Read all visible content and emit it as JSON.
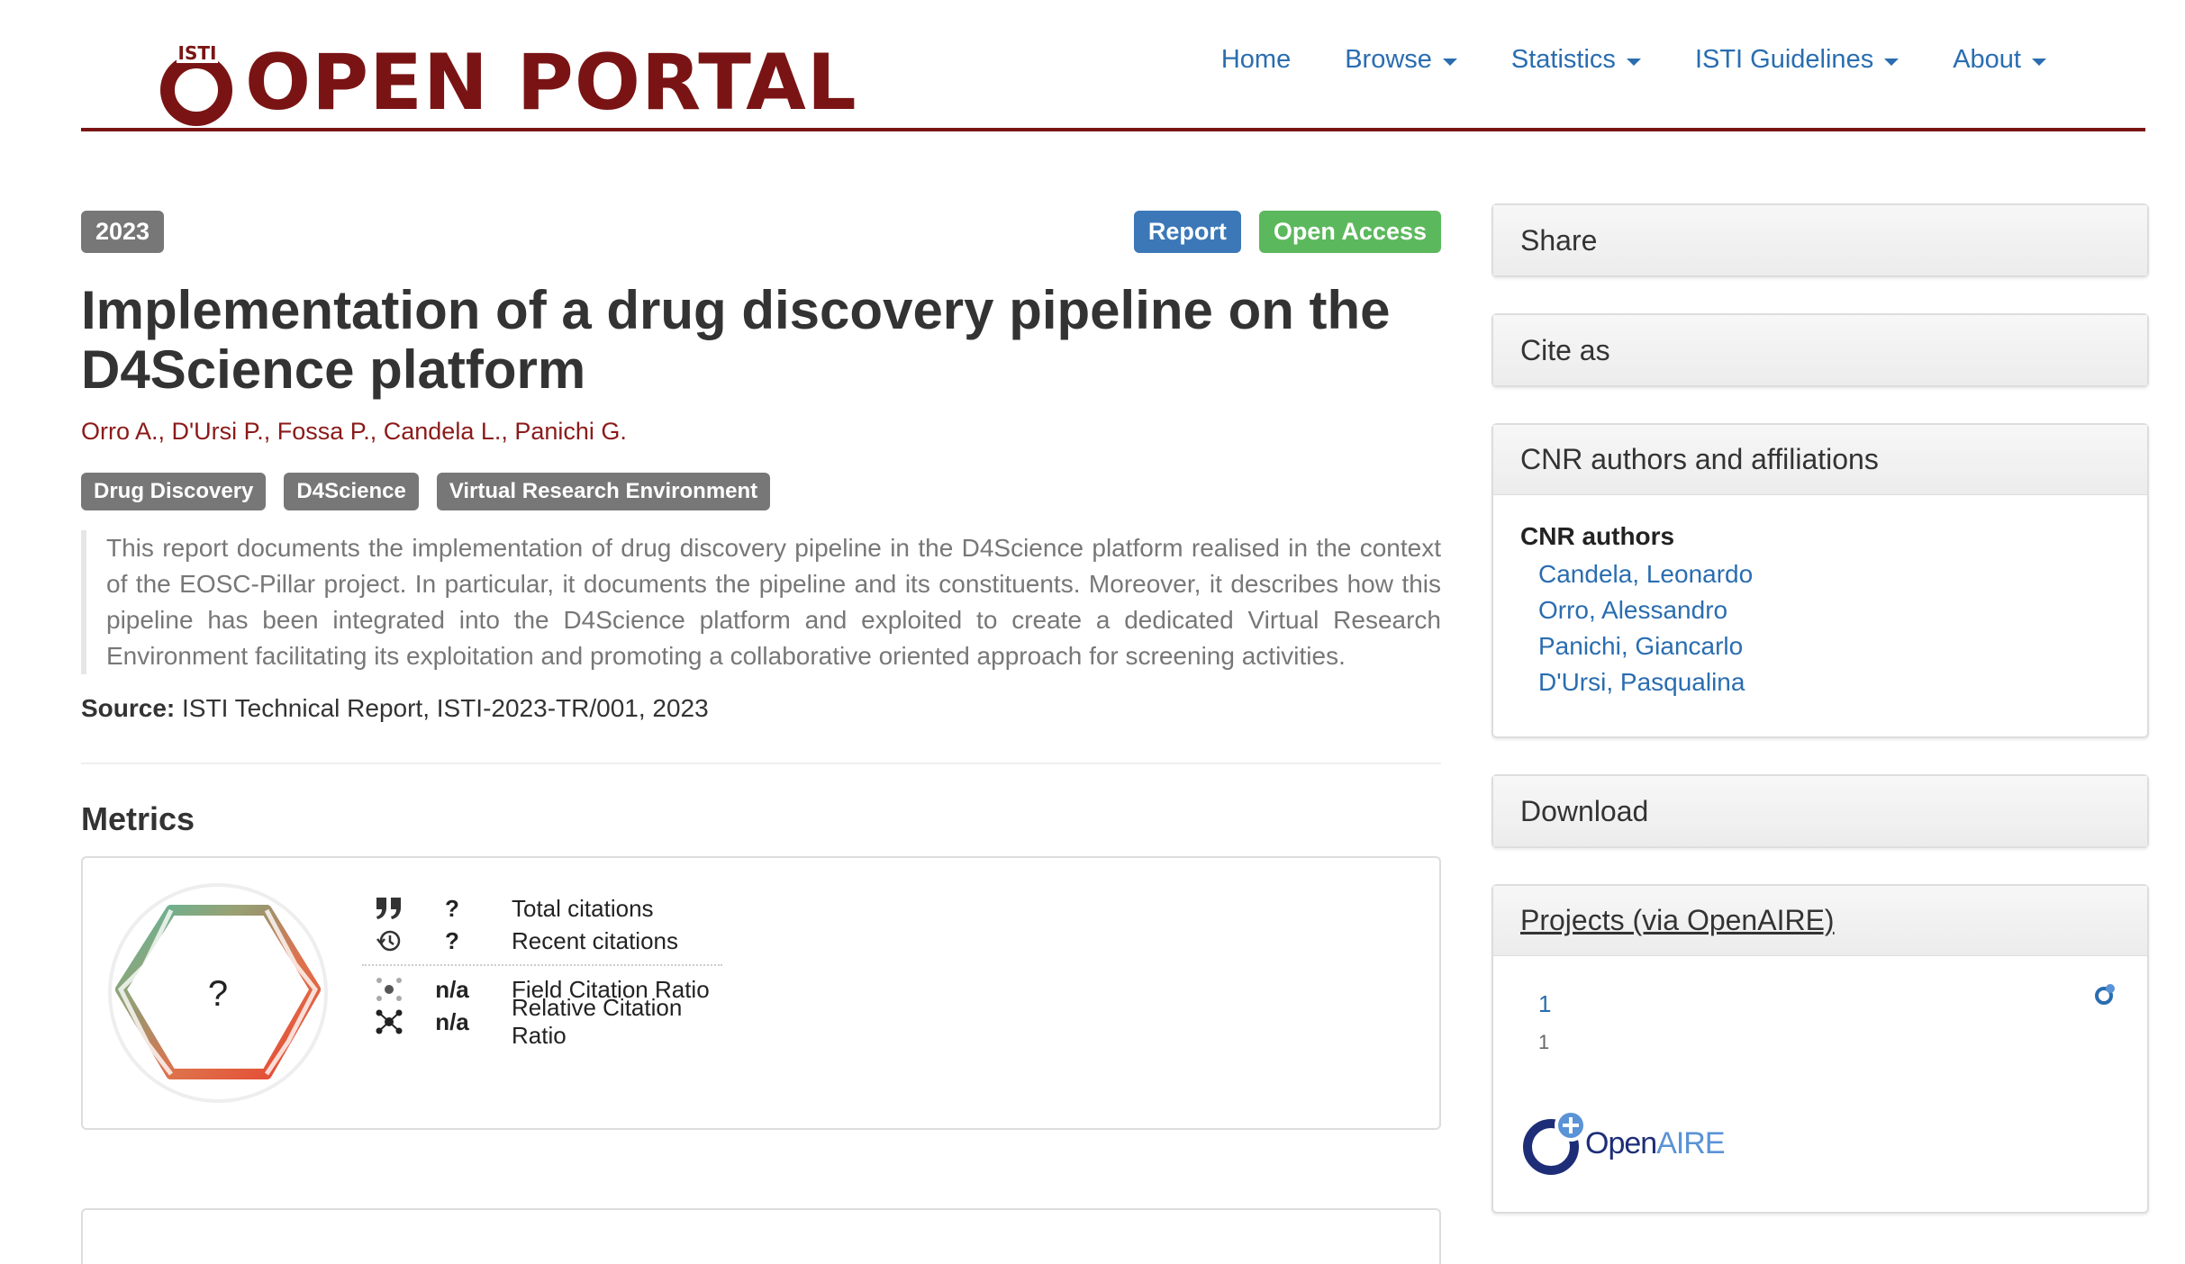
{
  "header": {
    "logo_text": "OPEN PORTAL",
    "logo_icon_text": "ISTI",
    "nav": [
      {
        "label": "Home",
        "dropdown": false
      },
      {
        "label": "Browse",
        "dropdown": true
      },
      {
        "label": "Statistics",
        "dropdown": true
      },
      {
        "label": "ISTI Guidelines",
        "dropdown": true
      },
      {
        "label": "About",
        "dropdown": true
      }
    ]
  },
  "record": {
    "year": "2023",
    "type_badge": "Report",
    "access_badge": "Open Access",
    "title": "Implementation of a drug discovery pipeline on the D4Science platform",
    "authors": "Orro A., D'Ursi P., Fossa P., Candela L., Panichi G.",
    "keywords": [
      "Drug Discovery",
      "D4Science",
      "Virtual Research Environment"
    ],
    "abstract": "This report documents the implementation of drug discovery pipeline in the D4Science platform realised in the context of the EOSC-Pillar project. In particular, it documents the pipeline and its constituents. Moreover, it describes how this pipeline has been integrated into the D4Science platform and exploited to create a dedicated Virtual Research Environment facilitating its exploitation and promoting a collaborative oriented approach for screening activities.",
    "source_label": "Source:",
    "source_value": "ISTI Technical Report, ISTI-2023-TR/001, 2023"
  },
  "metrics": {
    "title": "Metrics",
    "badge_value": "?",
    "rows": [
      {
        "icon": "quote-icon",
        "value": "?",
        "label": "Total citations"
      },
      {
        "icon": "history-icon",
        "value": "?",
        "label": "Recent citations"
      },
      {
        "icon": "network-light-icon",
        "value": "n/a",
        "label": "Field Citation Ratio"
      },
      {
        "icon": "network-dark-icon",
        "value": "n/a",
        "label": "Relative Citation Ratio"
      }
    ]
  },
  "sidebar": {
    "share": "Share",
    "cite": "Cite as",
    "cnr": {
      "title": "CNR authors and affiliations",
      "label": "CNR authors",
      "authors": [
        "Candela, Leonardo",
        "Orro, Alessandro",
        "Panichi, Giancarlo",
        "D'Ursi, Pasqualina"
      ]
    },
    "download": "Download",
    "projects": {
      "title": "Projects (via OpenAIRE)",
      "number": "1",
      "sub": "1",
      "logo_open": "Open",
      "logo_aire": "AIRE"
    }
  },
  "colors": {
    "brand": "#7a1414",
    "link": "#2a6db0",
    "report_badge": "#3c78b8",
    "open_access_badge": "#5cb85c",
    "grey_badge": "#777777"
  }
}
